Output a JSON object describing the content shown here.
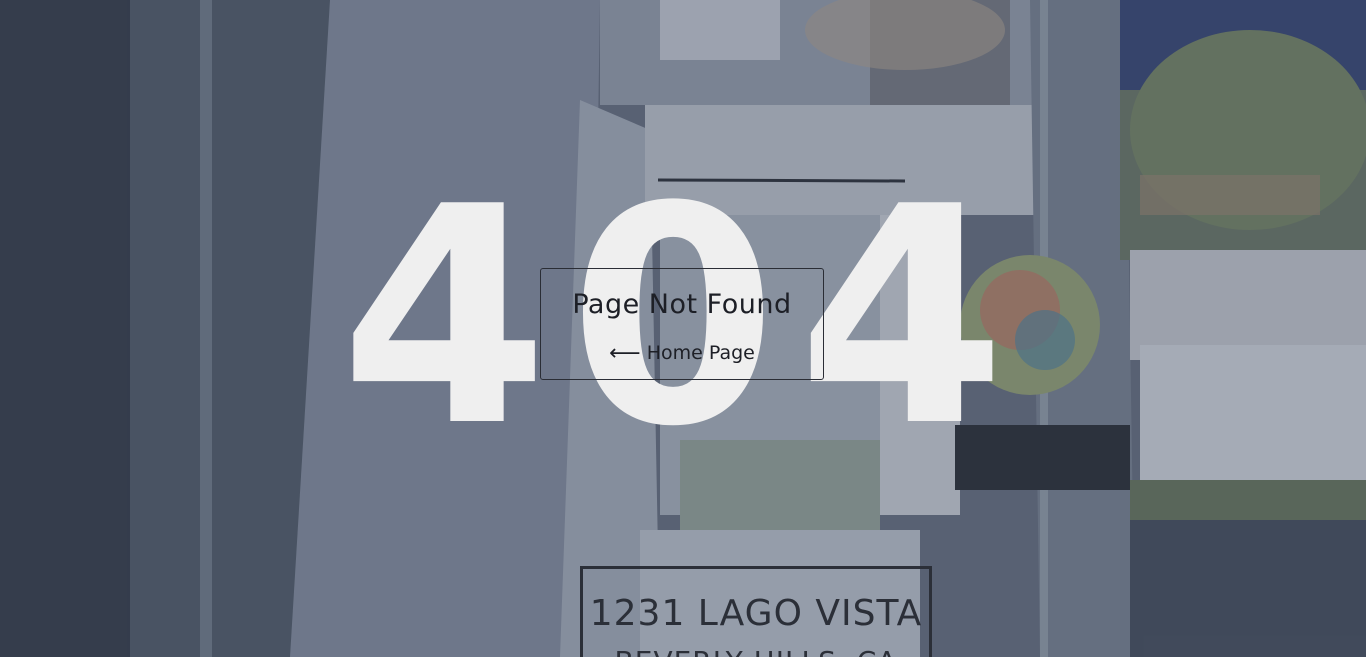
{
  "error": {
    "code": "404",
    "title": "Page Not Found"
  },
  "nav": {
    "home_link_label": "Home Page",
    "home_link_icon": "arrow-left-icon"
  },
  "background": {
    "sign_line1": "1231 LAGO VISTA",
    "sign_line2": "BEVERLY HILLS, CA"
  },
  "colors": {
    "big_text": "#efefef",
    "box_text": "#1d1f26",
    "overlay": "rgba(40,50,70,0.28)"
  }
}
